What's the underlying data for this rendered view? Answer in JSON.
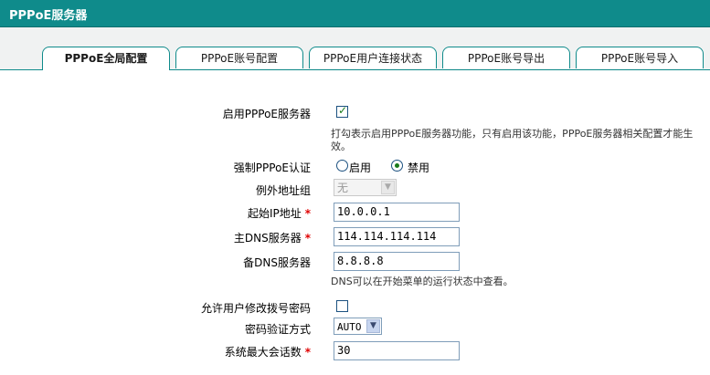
{
  "title": "PPPoE服务器",
  "tabs": [
    {
      "label": "PPPoE全局配置",
      "active": true
    },
    {
      "label": "PPPoE账号配置",
      "active": false
    },
    {
      "label": "PPPoE用户连接状态",
      "active": false
    },
    {
      "label": "PPPoE账号导出",
      "active": false
    },
    {
      "label": "PPPoE账号导入",
      "active": false
    }
  ],
  "form": {
    "enable_server": {
      "label": "启用PPPoE服务器",
      "checked": true,
      "hint": "打勾表示启用PPPoE服务器功能，只有启用该功能，PPPoE服务器相关配置才能生效。"
    },
    "force_auth": {
      "label": "强制PPPoE认证",
      "option_enable": "启用",
      "option_disable": "禁用",
      "selected": "禁用"
    },
    "exception_group": {
      "label": "例外地址组",
      "value": "无"
    },
    "start_ip": {
      "label": "起始IP地址",
      "required_mark": "*",
      "value": "10.0.0.1"
    },
    "primary_dns": {
      "label": "主DNS服务器",
      "required_mark": "*",
      "value": "114.114.114.114"
    },
    "secondary_dns": {
      "label": "备DNS服务器",
      "value": "8.8.8.8",
      "hint": "DNS可以在开始菜单的运行状态中查看。"
    },
    "allow_change_password": {
      "label": "允许用户修改拨号密码",
      "checked": false
    },
    "auth_method": {
      "label": "密码验证方式",
      "value": "AUTO"
    },
    "max_sessions": {
      "label": "系统最大会话数",
      "required_mark": "*",
      "value": "30"
    }
  }
}
